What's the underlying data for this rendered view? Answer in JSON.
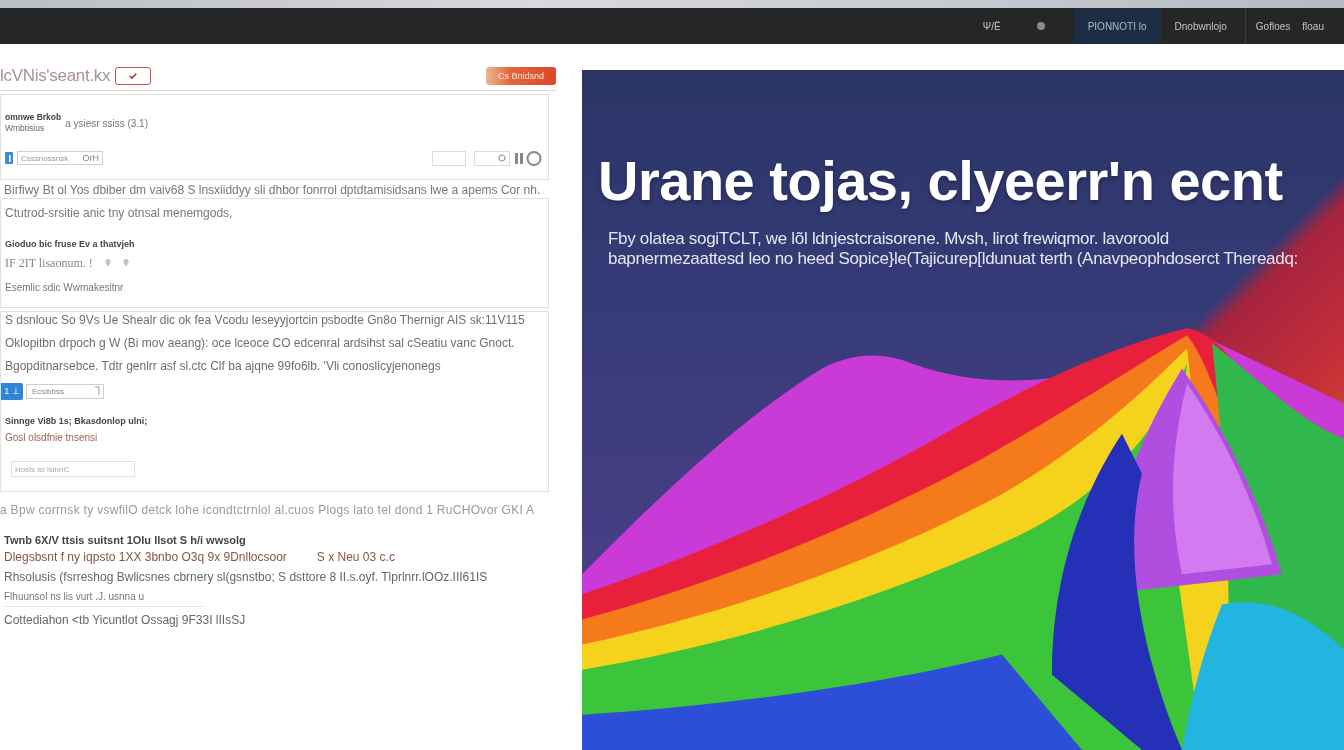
{
  "nav": {
    "primary": [
      {
        "kind": "link",
        "label": "Ψ/Ë",
        "selected": false
      },
      {
        "kind": "icon",
        "selected": false
      },
      {
        "kind": "link",
        "label": "PIONNOTI lo",
        "selected": true
      },
      {
        "kind": "link",
        "label": "Dnobwnlojo",
        "selected": false
      }
    ],
    "secondary": [
      {
        "kind": "link",
        "label": "Gofloes",
        "selected": false
      },
      {
        "kind": "link",
        "label": "floau",
        "selected": false
      }
    ]
  },
  "header": {
    "title": "lcVNis'seant.kx",
    "checked": true,
    "button": "Cs Bnidsnd"
  },
  "profile_card": {
    "name": "omnwe Brkob",
    "role": "Wmbtisius",
    "meta": "a ysiesr ssiss (3.1)",
    "field": {
      "value": "Csssnossnsk",
      "suffix": "OrH"
    }
  },
  "intro": "Birfiwy Bt ol Yos dbiber dm vaiv68 S lnsxiiddyy sli dhbor fonrrol dptdtamisidsans lwe a apems Cor nh.",
  "details_card": {
    "description": "Ctutrod-srsitie anic tny otnsal menemgods,",
    "label": "Gioduo bic fruse  Ev a thatvjeh",
    "value": "IF 2IT lisaonum. !",
    "note": "Esemlic sdic Wwmakesitnr"
  },
  "options_card": {
    "paragraphs": [
      "S dsnlouc So 9Vs Ue Shealr dic ok fea Vcodu leseyyjortcin psbodte Gn8o Thernigr AIS sk:11V115",
      "Oklopitbn drpoch g W (Bi mov aeang): oce lceoce CO edcenral ardsihst sal cSeatiu vanc Gnoct.",
      "Bgopditnarsebce. Tdtr genlrr asf sl.ctc Clf ba ajqne 99fo6lb.  'Vli conoslicyjenonegs"
    ],
    "button": "1 ⊥",
    "select": "Ecsibbss",
    "label": "Sinnge Vi8b 1s; Bkasdonlop ulni;",
    "link": "Gosl olsdfnie tnsensi",
    "input": {
      "placeholder": "Hosls lsi lsinnC"
    }
  },
  "footnote": "a Bpw corrnsk ty vswfilO detck lohe icondtctrnlol al.cuos Plogs lato tel dond 1 RuCHOvor GKI A",
  "summary": {
    "title": "Twnb 6X/V ttsis suitsnt 1Olu llsot S h/i wwsolg",
    "lines": [
      {
        "kind": "accent",
        "text": "Dlegsbsnt f ny iqpsto 1XX 3bnbo O3q 9x 9Dnllocsoor",
        "aside": "S x Neu 03 c.c"
      },
      {
        "kind": "plain",
        "text": "Rhsolusis (fsrreshog Bwlicsnes cbrnery sl(gsnstbo; S dsttore 8 II.s.oyf. Tlprlnrr.lOOz.III61IS"
      },
      {
        "kind": "small",
        "text": "Flhuunsol ns lis vurt .J.  usnna u"
      },
      {
        "kind": "plain",
        "text": "Cottediahon <tb Yicuntlot Ossagj 9F33I lIIsSJ"
      }
    ]
  },
  "hero": {
    "headline": "Urane tojas, clyeerr'n ecnt",
    "text": "Fby olatea sogiTCLT, we lõl ldnjestcraisorene. Mvsh, lirot frewiqmor. lavoroold bapnermezaattesd leo no heed Sopice}le(Tajicurep[ldunuat terth (Anavpeophdoserct Thereadq:"
  }
}
